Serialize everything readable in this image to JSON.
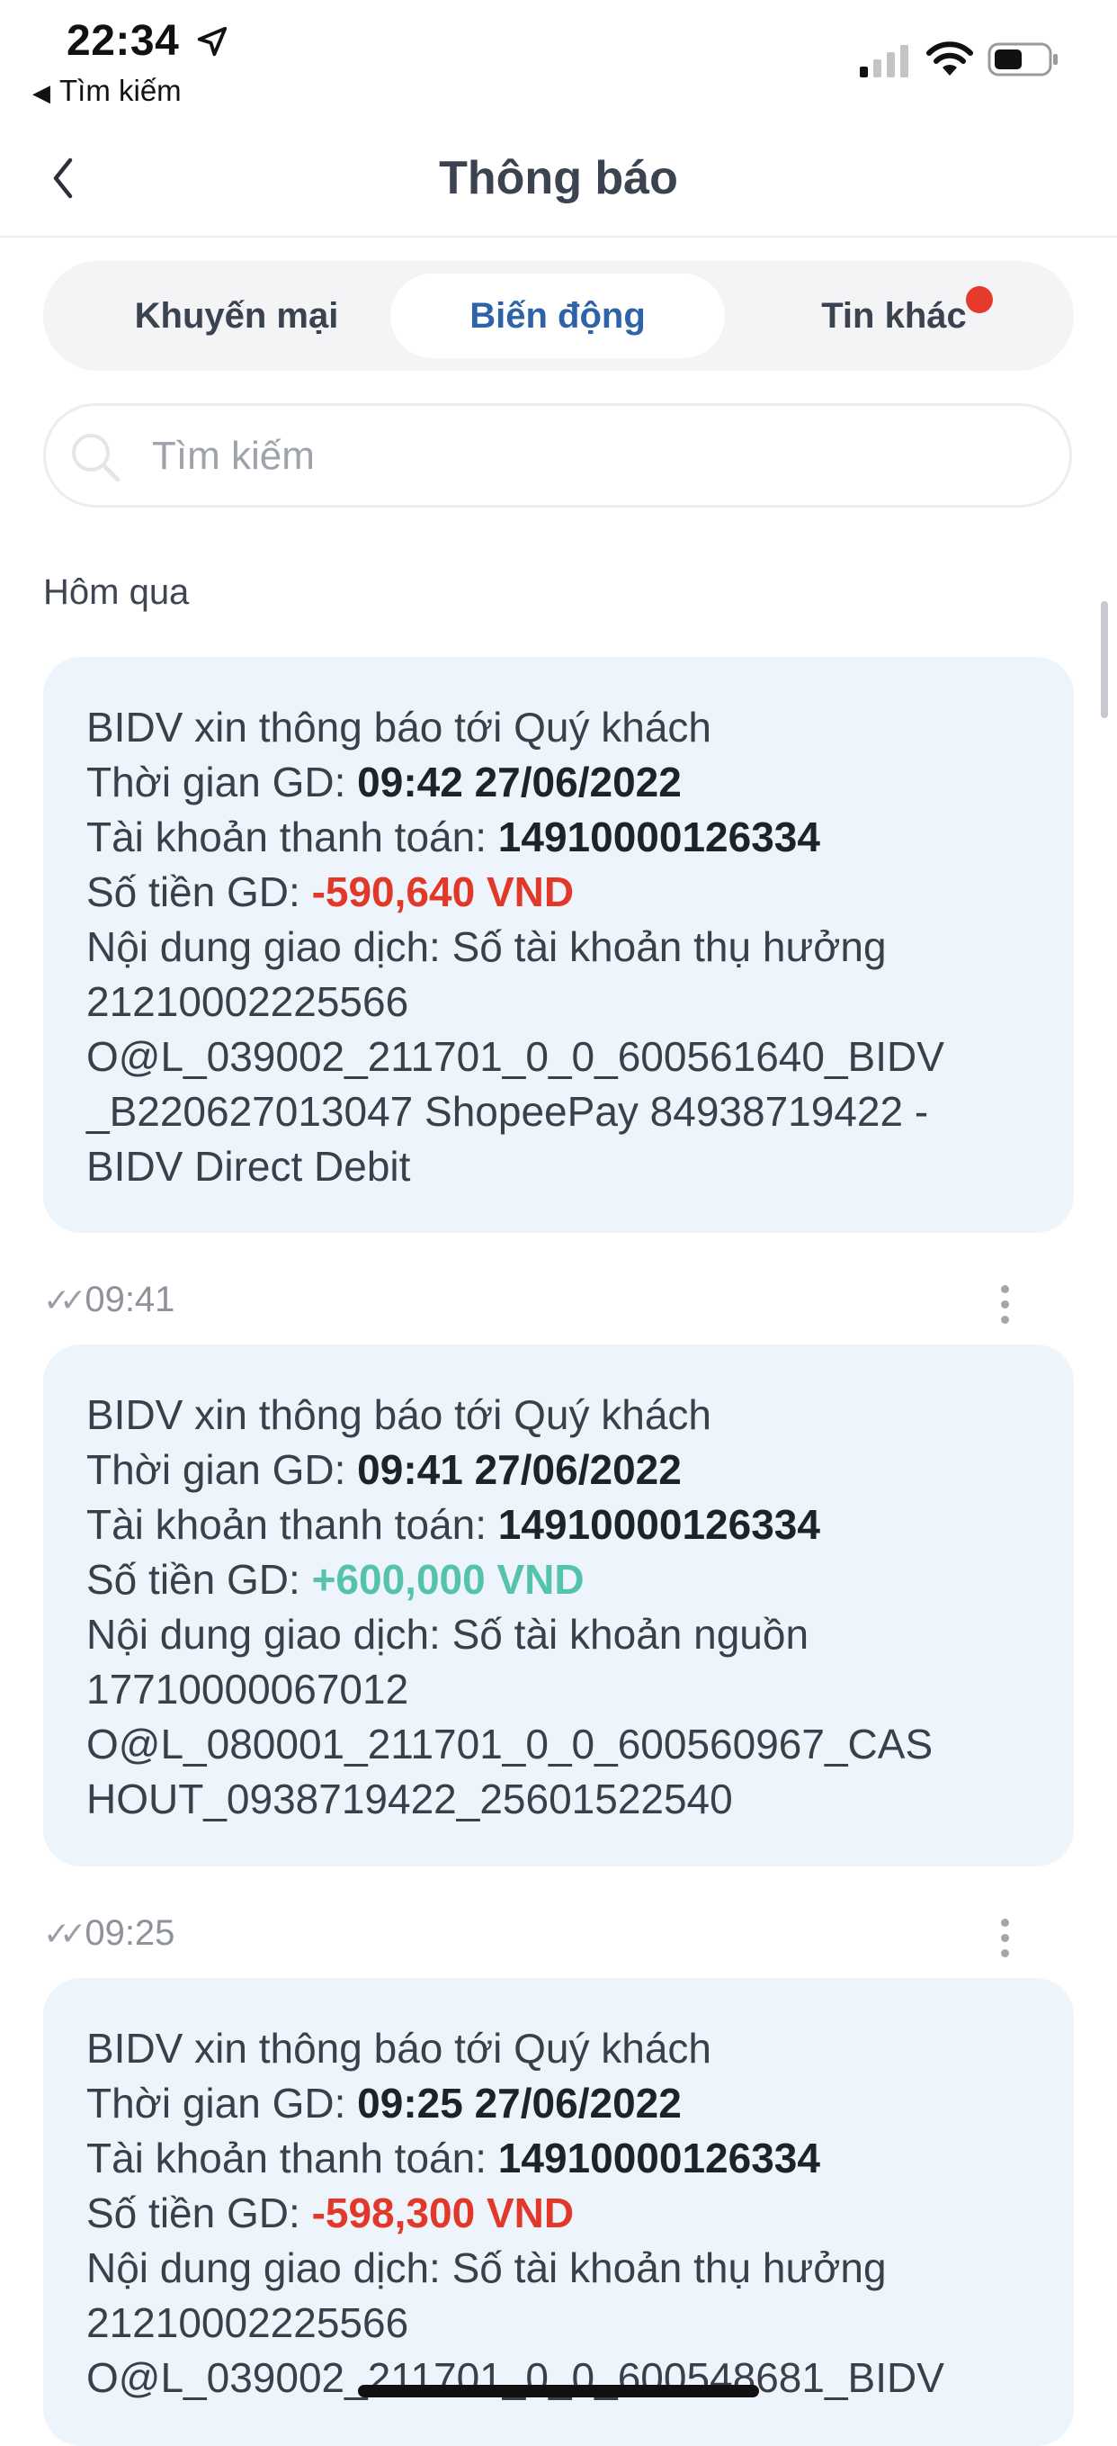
{
  "status_bar": {
    "time": "22:34",
    "back_app": "Tìm kiếm"
  },
  "header": {
    "title": "Thông báo"
  },
  "tabs": [
    {
      "label": "Khuyến mại",
      "active": false
    },
    {
      "label": "Biến động",
      "active": true
    },
    {
      "label": "Tin khác",
      "active": false,
      "badge": true
    }
  ],
  "search": {
    "placeholder": "Tìm kiếm"
  },
  "day_label": "Hôm qua",
  "messages": [
    {
      "title": "BIDV xin thông báo tới Quý khách",
      "time_label": "Thời gian GD: ",
      "time_value": "09:42 27/06/2022",
      "account_label": "Tài khoản thanh toán: ",
      "account_value": "14910000126334",
      "amount_label": "Số tiền GD: ",
      "amount_value": "-590,640 VND",
      "content_label": "Nội dung giao dịch: ",
      "content_lines": [
        "Số tài khoản thụ hưởng",
        "21210002225566",
        "O@L_039002_211701_0_0_600561640_BIDV",
        "_B220627013047 ShopeePay 84938719422 -",
        "BIDV Direct Debit"
      ]
    },
    {
      "meta_time": "09:41",
      "title": "BIDV xin thông báo tới Quý khách",
      "time_label": "Thời gian GD: ",
      "time_value": "09:41 27/06/2022",
      "account_label": "Tài khoản thanh toán: ",
      "account_value": "14910000126334",
      "amount_label": "Số tiền GD: ",
      "amount_value": "+600,000 VND",
      "content_label": "Nội dung giao dịch: ",
      "content_lines": [
        "Số tài khoản nguồn",
        "17710000067012",
        "O@L_080001_211701_0_0_600560967_CAS",
        "HOUT_0938719422_25601522540"
      ]
    },
    {
      "meta_time": "09:25",
      "title": "BIDV xin thông báo tới Quý khách",
      "time_label": "Thời gian GD: ",
      "time_value": "09:25 27/06/2022",
      "account_label": "Tài khoản thanh toán: ",
      "account_value": "14910000126334",
      "amount_label": "Số tiền GD: ",
      "amount_value": "-598,300 VND",
      "content_label": "Nội dung giao dịch: ",
      "content_lines": [
        "Số tài khoản thụ hưởng",
        "21210002225566",
        "O@L_039002_211701_0_0_600548681_BIDV"
      ]
    }
  ],
  "colors": {
    "accent_blue": "#2e62a9",
    "negative": "#e2382a",
    "positive": "#55c2ae",
    "card_bg": "#eef4fb",
    "badge": "#e53a2c"
  }
}
